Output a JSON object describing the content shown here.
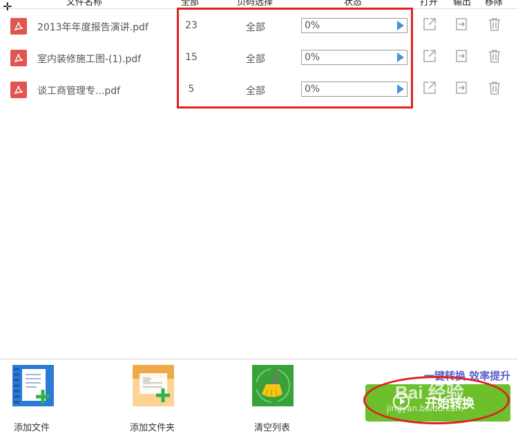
{
  "header": {
    "columns": [
      "文件名称",
      "全部",
      "页码选择",
      "状态",
      "打开",
      "输出",
      "移除"
    ]
  },
  "files": [
    {
      "name": "2013年年度报告演讲.pdf",
      "pages": "23",
      "range": "全部",
      "progress": "0%",
      "progress_value": 0
    },
    {
      "name": "室内装修施工图-(1).pdf",
      "pages": "15",
      "range": "全部",
      "progress": "0%",
      "progress_value": 0
    },
    {
      "name": "谈工商管理专...pdf",
      "pages": "5",
      "range": "全部",
      "progress": "0%",
      "progress_value": 0
    }
  ],
  "toolbar": {
    "add_file": "添加文件",
    "add_folder": "添加文件夹",
    "clear_list": "清空列表"
  },
  "slogan": "一键转换 效率提升",
  "start_button": "开始转换",
  "watermark": {
    "text": "Bai 经验",
    "url": "jingyan.baidu.com"
  },
  "colors": {
    "pdf_icon": "#e05551",
    "start_button": "#6dbf2c",
    "highlight": "#e02020",
    "slogan": "#5a62c8",
    "play_arrow": "#4a90e2"
  }
}
